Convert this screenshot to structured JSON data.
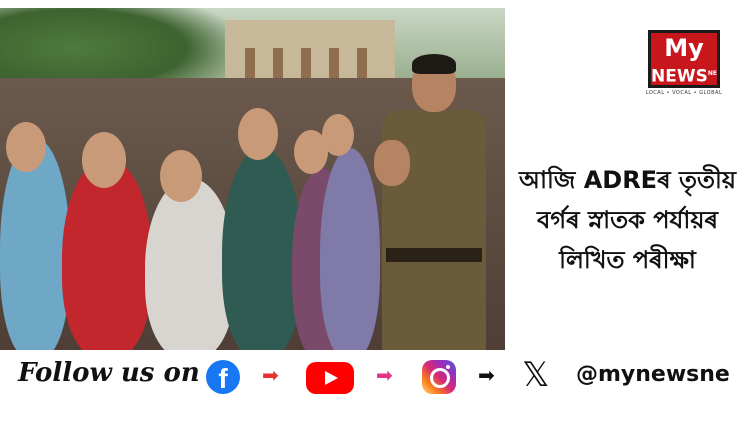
{
  "logo": {
    "line1": "My",
    "line2": "NEWS",
    "line2_suffix": "NE",
    "tagline": "LOCAL • VOCAL • GLOBAL"
  },
  "headline": {
    "lines": [
      "আজি ADREৰ তৃতীয়",
      "বৰ্গৰ স্নাতক পৰ্যায়ৰ",
      "লিখিত পৰীক্ষা"
    ]
  },
  "footer": {
    "follow_text": "Follow us on",
    "handle": "@mynewsne"
  },
  "colors": {
    "brand_red": "#c8161d",
    "facebook_blue": "#1877f2",
    "youtube_red": "#ff0000"
  },
  "icons": [
    "facebook-icon",
    "youtube-icon",
    "instagram-icon",
    "x-twitter-icon",
    "arrow-right-icon"
  ]
}
